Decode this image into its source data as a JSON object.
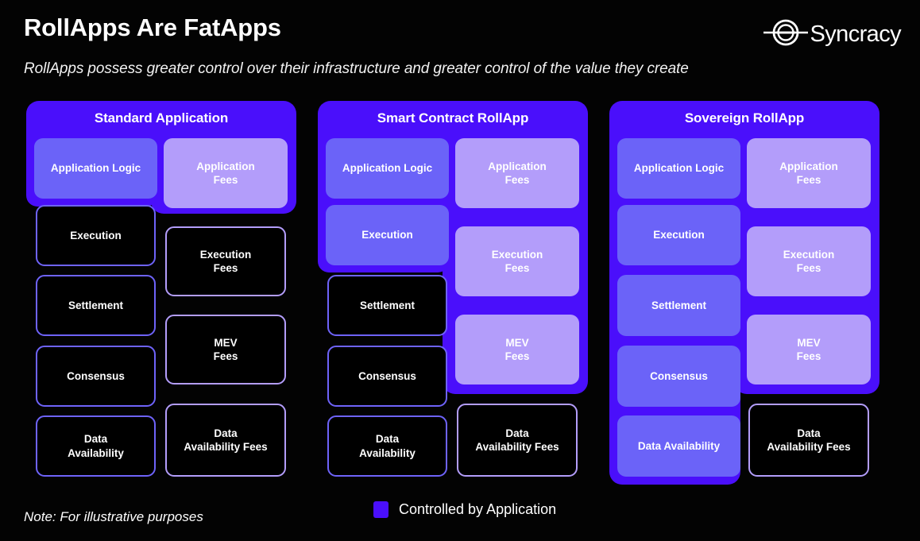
{
  "header": {
    "title": "RollApps Are FatApps",
    "subtitle": "RollApps possess greater control over their infrastructure and greater control of the value they create"
  },
  "brand": {
    "name": "Syncracy",
    "logo_icon": "syncracy-eclipse-icon"
  },
  "colors": {
    "background": "#000000",
    "panel_purple": "#4a0ffb",
    "stack_active": "#6b63f8",
    "stack_outline": "#6e63f9",
    "fee_active": "#b39dfa",
    "fee_outline": "#b39dfa",
    "text": "#ffffff"
  },
  "columns": [
    {
      "id": "standard-application",
      "title": "Standard Application",
      "stack": [
        {
          "label": "Application Logic",
          "controlled": true
        },
        {
          "label": "Execution",
          "controlled": false
        },
        {
          "label": "Settlement",
          "controlled": false
        },
        {
          "label": "Consensus",
          "controlled": false
        },
        {
          "label": "Data\nAvailability",
          "line1": "Data",
          "line2": "Availability",
          "controlled": false
        }
      ],
      "fees": [
        {
          "line1": "Application",
          "line2": "Fees",
          "captured": true
        },
        {
          "line1": "Execution",
          "line2": "Fees",
          "captured": false
        },
        {
          "line1": "MEV",
          "line2": "Fees",
          "captured": false
        },
        {
          "line1": "Data",
          "line2": "Availability Fees",
          "captured": false
        }
      ]
    },
    {
      "id": "smart-contract-rollapp",
      "title": "Smart Contract RollApp",
      "stack": [
        {
          "label": "Application Logic",
          "controlled": true
        },
        {
          "label": "Execution",
          "controlled": true
        },
        {
          "label": "Settlement",
          "controlled": false
        },
        {
          "label": "Consensus",
          "controlled": false
        },
        {
          "line1": "Data",
          "line2": "Availability",
          "controlled": false
        }
      ],
      "fees": [
        {
          "line1": "Application",
          "line2": "Fees",
          "captured": true
        },
        {
          "line1": "Execution",
          "line2": "Fees",
          "captured": true
        },
        {
          "line1": "MEV",
          "line2": "Fees",
          "captured": true
        },
        {
          "line1": "Data",
          "line2": "Availability Fees",
          "captured": false
        }
      ]
    },
    {
      "id": "sovereign-rollapp",
      "title": "Sovereign RollApp",
      "stack": [
        {
          "label": "Application Logic",
          "controlled": true
        },
        {
          "label": "Execution",
          "controlled": true
        },
        {
          "label": "Settlement",
          "controlled": true
        },
        {
          "label": "Consensus",
          "controlled": true
        },
        {
          "label": "Data Availability",
          "controlled": true
        }
      ],
      "fees": [
        {
          "line1": "Application",
          "line2": "Fees",
          "captured": true
        },
        {
          "line1": "Execution",
          "line2": "Fees",
          "captured": true
        },
        {
          "line1": "MEV",
          "line2": "Fees",
          "captured": true
        },
        {
          "line1": "Data",
          "line2": "Availability Fees",
          "captured": false
        }
      ]
    }
  ],
  "footer": {
    "note": "Note: For illustrative purposes",
    "legend_label": "Controlled by Application"
  },
  "labels": {
    "c1": {
      "title": "Standard Application",
      "s0": "Application Logic",
      "s1": "Execution",
      "s2": "Settlement",
      "s3": "Consensus",
      "s4a": "Data",
      "s4b": "Availability",
      "f0a": "Application",
      "f0b": "Fees",
      "f1a": "Execution",
      "f1b": "Fees",
      "f2a": "MEV",
      "f2b": "Fees",
      "f3a": "Data",
      "f3b": "Availability Fees"
    },
    "c2": {
      "title": "Smart Contract RollApp",
      "s0": "Application Logic",
      "s1": "Execution",
      "s2": "Settlement",
      "s3": "Consensus",
      "s4a": "Data",
      "s4b": "Availability",
      "f0a": "Application",
      "f0b": "Fees",
      "f1a": "Execution",
      "f1b": "Fees",
      "f2a": "MEV",
      "f2b": "Fees",
      "f3a": "Data",
      "f3b": "Availability Fees"
    },
    "c3": {
      "title": "Sovereign RollApp",
      "s0": "Application Logic",
      "s1": "Execution",
      "s2": "Settlement",
      "s3": "Consensus",
      "s4": "Data Availability",
      "f0a": "Application",
      "f0b": "Fees",
      "f1a": "Execution",
      "f1b": "Fees",
      "f2a": "MEV",
      "f2b": "Fees",
      "f3a": "Data",
      "f3b": "Availability Fees"
    }
  }
}
